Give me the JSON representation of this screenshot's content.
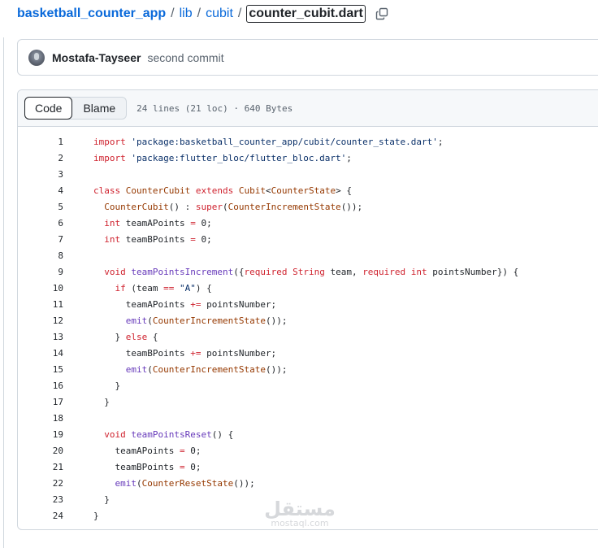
{
  "breadcrumb": {
    "repo": "basketball_counter_app",
    "sep1": "/",
    "dir1": "lib",
    "sep2": "/",
    "dir2": "cubit",
    "sep3": "/",
    "file": "counter_cubit.dart"
  },
  "commit": {
    "author": "Mostafa-Tayseer",
    "message": "second commit"
  },
  "file_view": {
    "tabs": [
      "Code",
      "Blame"
    ],
    "active_tab": "Code",
    "info": "24 lines (21 loc) · 640 Bytes"
  },
  "code_lines": [
    "import 'package:basketball_counter_app/cubit/counter_state.dart';",
    "import 'package:flutter_bloc/flutter_bloc.dart';",
    "",
    "class CounterCubit extends Cubit<CounterState> {",
    "  CounterCubit() : super(CounterIncrementState());",
    "  int teamAPoints = 0;",
    "  int teamBPoints = 0;",
    "",
    "  void teamPointsIncrement({required String team, required int pointsNumber}) {",
    "    if (team == \"A\") {",
    "      teamAPoints += pointsNumber;",
    "      emit(CounterIncrementState());",
    "    } else {",
    "      teamBPoints += pointsNumber;",
    "      emit(CounterIncrementState());",
    "    }",
    "  }",
    "",
    "  void teamPointsReset() {",
    "    teamAPoints = 0;",
    "    teamBPoints = 0;",
    "    emit(CounterResetState());",
    "  }",
    "}"
  ],
  "watermark": {
    "main": "مستقل",
    "sub": "mostaql.com"
  },
  "colors": {
    "link": "#0969da",
    "keyword": "#cf222e",
    "string": "#0a3069",
    "type": "#953800",
    "function": "#6639ba",
    "border": "#d0d7de"
  },
  "icons": [
    "copy-path-icon",
    "avatar"
  ]
}
